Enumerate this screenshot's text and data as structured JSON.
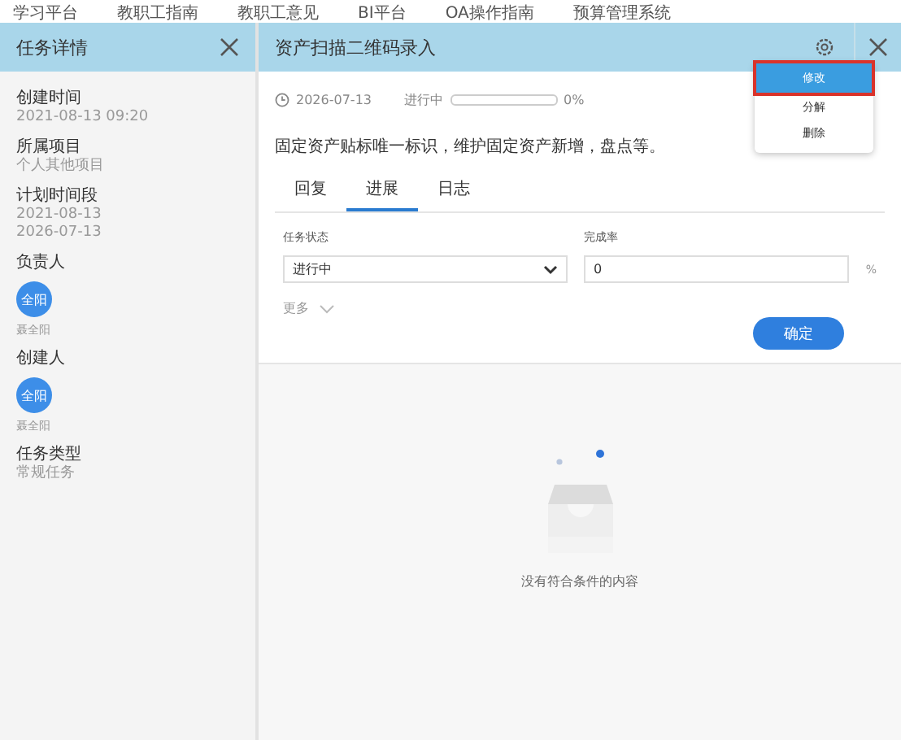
{
  "top_nav": [
    "学习平台",
    "教职工指南",
    "教职工意见",
    "BI平台",
    "OA操作指南",
    "预算管理系统"
  ],
  "left_panel": {
    "title": "任务详情",
    "fields": [
      {
        "kind": "text",
        "label": "创建时间",
        "values": [
          "2021-08-13 09:20"
        ]
      },
      {
        "kind": "text",
        "label": "所属项目",
        "values": [
          "个人其他项目"
        ]
      },
      {
        "kind": "text",
        "label": "计划时间段",
        "values": [
          "2021-08-13",
          "2026-07-13"
        ]
      },
      {
        "kind": "person",
        "label": "负责人",
        "avatar": "全阳",
        "values": [
          "聂全阳"
        ]
      },
      {
        "kind": "person",
        "label": "创建人",
        "avatar": "全阳",
        "values": [
          "聂全阳"
        ]
      },
      {
        "kind": "text",
        "label": "任务类型",
        "values": [
          "常规任务"
        ]
      }
    ]
  },
  "task": {
    "title": "资产扫描二维码录入",
    "due": "2026-07-13",
    "status": "进行中",
    "progress": {
      "level": 0,
      "reading": "0%"
    },
    "description": "固定资产贴标唯一标识，维护固定资产新增，盘点等。",
    "tabs": [
      {
        "label": "回复",
        "selected": false
      },
      {
        "label": "进展",
        "selected": true
      },
      {
        "label": "日志",
        "selected": false
      }
    ],
    "form": {
      "status_label": "任务状态",
      "status_value": "进行中",
      "rate_label": "完成率",
      "rate_value": "0",
      "rate_unit": "%",
      "more": "更多",
      "submit": "确定"
    },
    "empty_text": "没有符合条件的内容"
  },
  "menu": [
    {
      "label": "修改",
      "selected": true
    },
    {
      "label": "分解",
      "selected": false
    },
    {
      "label": "删除",
      "selected": false
    }
  ]
}
